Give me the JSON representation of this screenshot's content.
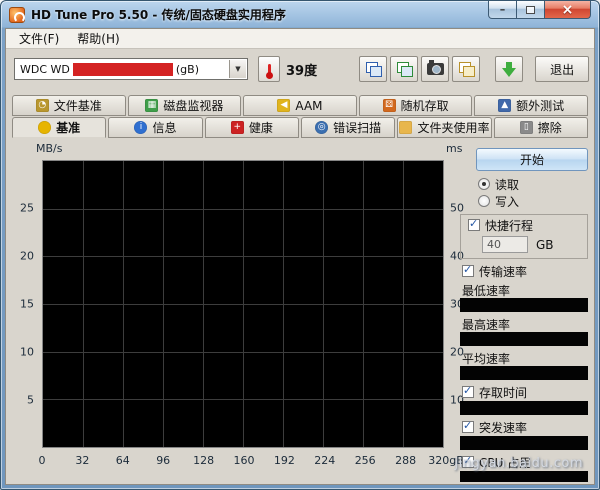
{
  "window": {
    "title": "HD Tune Pro 5.50 - 传统/固态硬盘实用程序",
    "minimize_glyph": "–",
    "close_glyph": "×"
  },
  "menu": {
    "items": [
      {
        "name": "menu-file",
        "label": "文件(F)"
      },
      {
        "name": "menu-help",
        "label": "帮助(H)"
      }
    ]
  },
  "toolbar": {
    "drive": {
      "prefix": "WDC WD",
      "suffix": "(gB)"
    },
    "temperature_value": "39度",
    "buttons": [
      {
        "name": "copy-screenshot-button",
        "icon": "screenshot-copy-icon",
        "variant": "blue"
      },
      {
        "name": "save-screenshot-button",
        "icon": "screenshot-save-icon",
        "variant": "green"
      },
      {
        "name": "camera-button",
        "icon": "camera-icon",
        "variant": "camera"
      },
      {
        "name": "save-text-button",
        "icon": "text-save-icon",
        "variant": "yellow"
      },
      {
        "name": "update-button",
        "icon": "download-arrow-icon",
        "variant": "arrow"
      }
    ],
    "exit_label": "退出"
  },
  "tabs_top": [
    {
      "name": "tab-file-benchmark",
      "label": "文件基准",
      "icon": "file-benchmark-icon",
      "icon_color": "#b9972e",
      "glyph": "◔",
      "shape": "square"
    },
    {
      "name": "tab-disk-monitor",
      "label": "磁盘监视器",
      "icon": "disk-monitor-icon",
      "icon_color": "#3f9e4a",
      "glyph": "▦",
      "shape": "square"
    },
    {
      "name": "tab-aam",
      "label": "AAM",
      "icon": "aam-speaker-icon",
      "icon_color": "#e0b41e",
      "glyph": "◀",
      "shape": "square"
    },
    {
      "name": "tab-random-access",
      "label": "随机存取",
      "icon": "random-access-icon",
      "icon_color": "#d2691e",
      "glyph": "⚄",
      "shape": "square"
    },
    {
      "name": "tab-extra-tests",
      "label": "额外测试",
      "icon": "extra-tests-icon",
      "icon_color": "#4169aa",
      "glyph": "▲",
      "shape": "square"
    }
  ],
  "tabs_bottom": [
    {
      "name": "tab-benchmark",
      "label": "基准",
      "icon": "key-icon",
      "icon_color": "#e6b400",
      "glyph": "",
      "shape": "circle",
      "active": true
    },
    {
      "name": "tab-info",
      "label": "信息",
      "icon": "info-icon",
      "icon_color": "#2f6fd0",
      "glyph": "i",
      "shape": "circle"
    },
    {
      "name": "tab-health",
      "label": "健康",
      "icon": "health-cross-icon",
      "icon_color": "#cc2222",
      "glyph": "+",
      "shape": "square"
    },
    {
      "name": "tab-error-scan",
      "label": "错误扫描",
      "icon": "error-scan-icon",
      "icon_color": "#3b6fb0",
      "glyph": "◎",
      "shape": "circle"
    },
    {
      "name": "tab-folder-usage",
      "label": "文件夹使用率",
      "icon": "folder-icon",
      "icon_color": "#e8b64c",
      "glyph": "",
      "shape": "square"
    },
    {
      "name": "tab-erase",
      "label": "擦除",
      "icon": "trash-icon",
      "icon_color": "#8a8a8a",
      "glyph": "▯",
      "shape": "square"
    }
  ],
  "chart": {
    "y_left_label": "MB/s",
    "y_left_ticks": [
      "25",
      "20",
      "15",
      "10",
      "5"
    ],
    "y_right_label": "ms",
    "y_right_ticks": [
      "50",
      "40",
      "30",
      "20",
      "10"
    ],
    "x_ticks": [
      "0",
      "32",
      "64",
      "96",
      "128",
      "160",
      "192",
      "224",
      "256",
      "288",
      "320gB"
    ]
  },
  "panel": {
    "start_label": "开始",
    "read_label": "读取",
    "write_label": "写入",
    "short_stroke_label": "快捷行程",
    "short_stroke_value": "40",
    "short_stroke_unit": "GB",
    "transfer_rate_label": "传输速率",
    "min_rate_label": "最低速率",
    "max_rate_label": "最高速率",
    "avg_rate_label": "平均速率",
    "access_time_label": "存取时间",
    "burst_rate_label": "突发速率",
    "cpu_usage_label": "CPU 占用"
  },
  "colors": {
    "redaction": "#d42323",
    "chart_bg": "#000000",
    "grid": "#3d3d3d"
  },
  "watermark": "jingyan.baidu.com"
}
